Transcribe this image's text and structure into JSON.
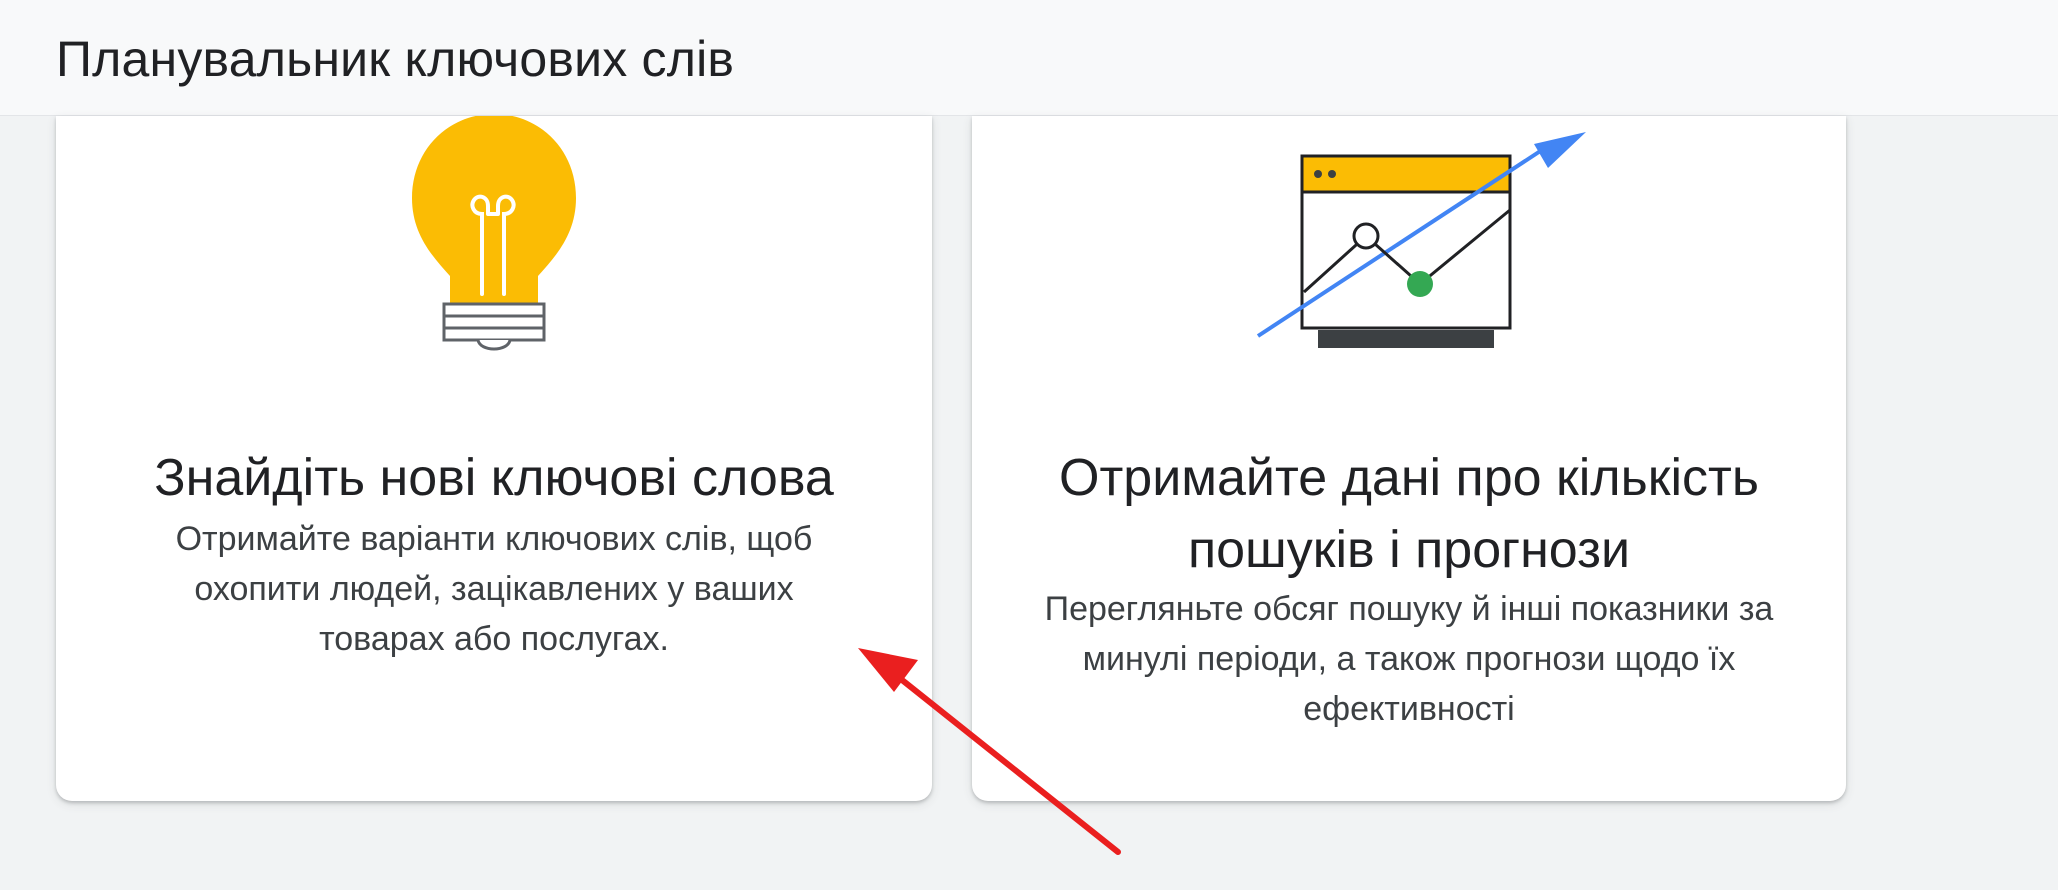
{
  "header": {
    "title": "Планувальник ключових слів"
  },
  "cards": [
    {
      "heading": "Знайдіть нові ключові слова",
      "description": "Отримайте варіанти ключових слів, щоб охопити людей, зацікавлених у ваших товарах або послугах.",
      "icon": "lightbulb-icon"
    },
    {
      "heading": "Отримайте дані про кількість пошуків і прогнози",
      "description": "Перегляньте обсяг пошуку й інші показники за минулі періоди, а також прогнози щодо їх ефективності",
      "icon": "trend-chart-icon"
    }
  ],
  "colors": {
    "bulb_yellow": "#fbbc04",
    "arrow_blue": "#4285f4",
    "point_green": "#34a853",
    "annotation_red": "#ea1f1f"
  }
}
